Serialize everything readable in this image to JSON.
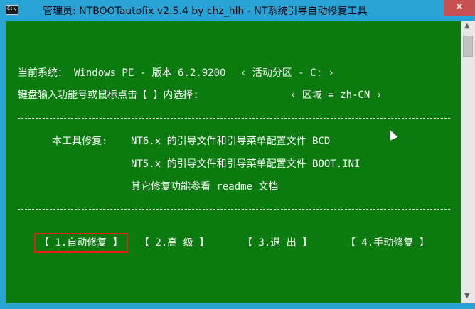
{
  "window": {
    "icon_text": "C:\\_",
    "title": "管理员: NTBOOTautofix v2.5.4 by chz_hlh - NT系统引导自动修复工具",
    "close_glyph": "✕"
  },
  "console": {
    "current_system_label": "当前系统：",
    "current_system_value": "Windows PE - 版本 6.2.9200",
    "active_partition": "‹ 活动分区 - C: ›",
    "prompt": "键盘输入功能号或鼠标点击【 】内选择:",
    "region": "‹ 区域 = zh-CN ›",
    "repair_label": "本工具修复:",
    "repair_lines": [
      "NT6.x 的引导文件和引导菜单配置文件 BCD",
      "NT5.x 的引导文件和引导菜单配置文件 BOOT.INI",
      "其它修复功能参看 readme 文档"
    ],
    "menu": [
      {
        "label": "【 1.自动修复 】",
        "selected": true
      },
      {
        "label": "【  2.高  级  】",
        "selected": false
      },
      {
        "label": "【  3.退  出  】",
        "selected": false
      },
      {
        "label": "【 4.手动修复 】",
        "selected": false
      }
    ]
  },
  "colors": {
    "console_bg": "#0b7a0f",
    "titlebar_bg": "#29a3d6",
    "selection_border": "#e8201b",
    "close_button": "#c75050"
  }
}
